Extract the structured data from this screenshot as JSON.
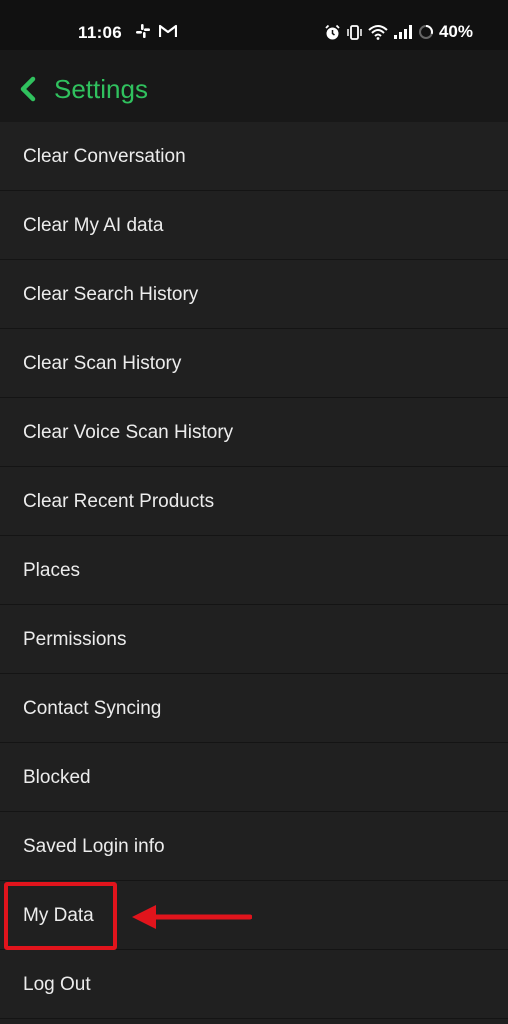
{
  "status_bar": {
    "time": "11:06",
    "battery": "40%",
    "icons_left": [
      "slack-icon",
      "gmail-icon"
    ],
    "icons_right": [
      "alarm-icon",
      "vibrate-icon",
      "wifi-icon",
      "signal-icon",
      "battery-icon"
    ]
  },
  "header": {
    "title": "Settings",
    "back_icon": "chevron-left-icon",
    "accent_color": "#30c15e"
  },
  "settings_items": [
    "Clear Conversation",
    "Clear My AI data",
    "Clear Search History",
    "Clear Scan History",
    "Clear Voice Scan History",
    "Clear Recent Products",
    "Places",
    "Permissions",
    "Contact Syncing",
    "Blocked",
    "Saved Login info",
    "My Data",
    "Log Out"
  ],
  "annotation": {
    "highlighted_item": "My Data",
    "color": "#e1141c"
  }
}
